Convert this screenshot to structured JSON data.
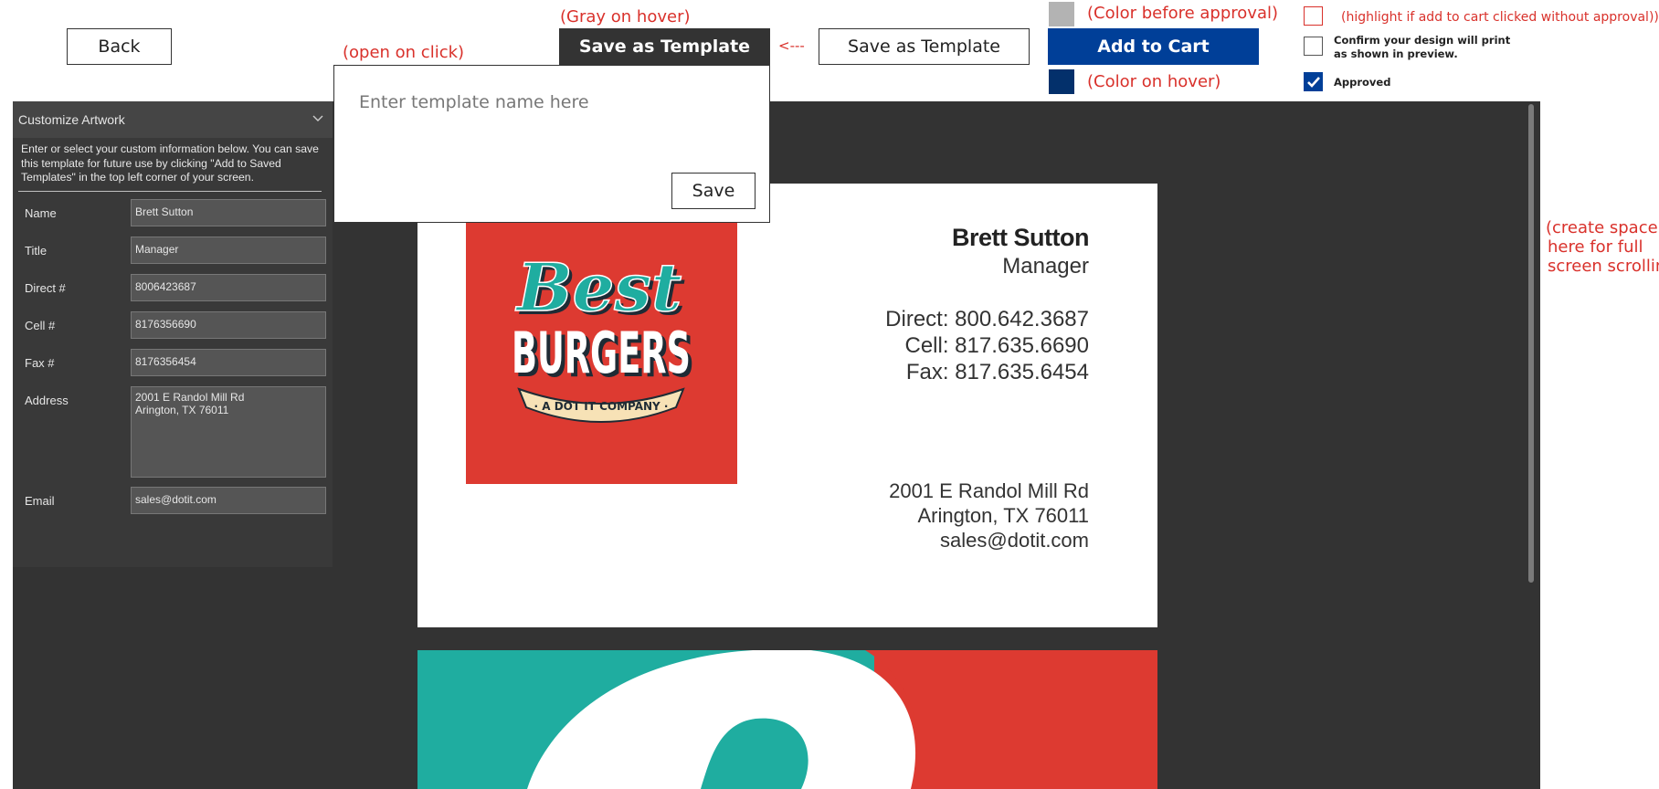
{
  "toolbar": {
    "back_label": "Back",
    "save_template_label": "Save as Template",
    "save_template_active_label": "Save as Template",
    "add_to_cart_label": "Add to Cart",
    "arrow_annotation": "<---",
    "colors": {
      "add_to_cart": "#003f98",
      "before_approval": "#b3b3b3",
      "on_hover": "#03306b",
      "active_template_button": "#333333"
    }
  },
  "annotations": {
    "gray_on_hover": "(Gray on hover)",
    "open_on_click": "(open on click)",
    "color_before_approval": "(Color before approval)",
    "color_on_hover": "(Color on hover)",
    "highlight_note": "(highlight if add to cart clicked without approval))",
    "space_line1": "(create space",
    "space_line2": "here for full",
    "space_line3": "screen scrolling)"
  },
  "approval": {
    "confirm_line1": "Confirm your design will print",
    "confirm_line2": "as shown in preview.",
    "approved_label": "Approved",
    "approved_checked": true
  },
  "template_popover": {
    "placeholder": "Enter template name here",
    "save_label": "Save"
  },
  "sidebar": {
    "title": "Customize Artwork",
    "intro": "Enter or select your custom information below.  You can save this template for future use by clicking \"Add to Saved Templates\" in the top left corner of your screen.",
    "fields": {
      "name": {
        "label": "Name",
        "value": "Brett Sutton"
      },
      "title": {
        "label": "Title",
        "value": "Manager"
      },
      "direct": {
        "label": "Direct #",
        "value": "8006423687"
      },
      "cell": {
        "label": "Cell #",
        "value": "8176356690"
      },
      "fax": {
        "label": "Fax #",
        "value": "8176356454"
      },
      "address": {
        "label": "Address",
        "value": "2001 E Randol Mill Rd\nArington, TX 76011"
      },
      "email": {
        "label": "Email",
        "value": "sales@dotit.com"
      }
    }
  },
  "card": {
    "logo": {
      "line1": "Best",
      "line2": "BURGERS",
      "ribbon": "· A DOT IT COMPANY ·"
    },
    "name": "Brett Sutton",
    "title": "Manager",
    "direct": "Direct: 800.642.3687",
    "cell": "Cell: 817.635.6690",
    "fax": "Fax: 817.635.6454",
    "address1": "2001 E Randol Mill Rd",
    "address2": "Arington, TX 76011",
    "email": "sales@dotit.com",
    "colors": {
      "logo_bg": "#dd3a31",
      "teal": "#1fada0",
      "cream": "#f7e2b6"
    }
  }
}
